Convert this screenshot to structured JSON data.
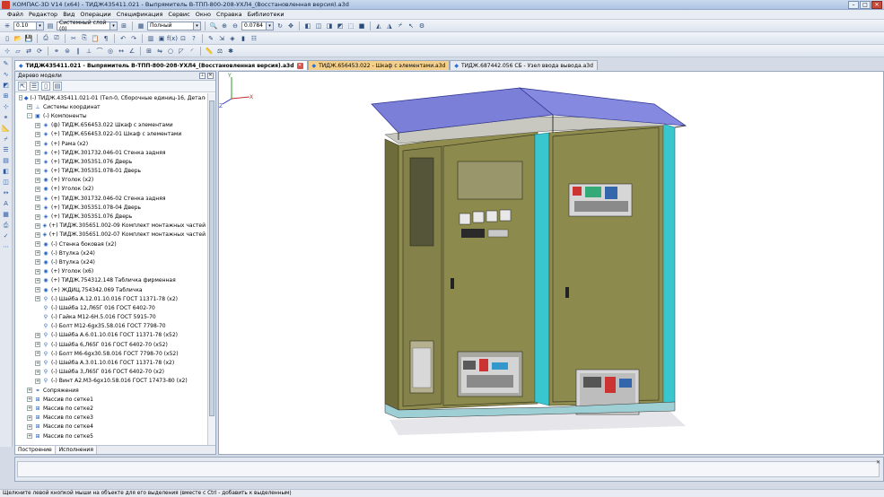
{
  "window": {
    "title": "КОМПАС-3D V14 (x64) - ТИДЖ435411.021 - Выпрямитель В-ТПП-800-208-УХЛ4_(Восстановленная версия).a3d"
  },
  "menu": [
    "Файл",
    "Редактор",
    "Вид",
    "Операции",
    "Спецификация",
    "Сервис",
    "Окно",
    "Справка",
    "Библиотеки"
  ],
  "toolbar": {
    "scale_value": "0.10",
    "layer_value": "Системный слой (0)",
    "view_mode_value": "Полный",
    "zoom_value": "0.0784"
  },
  "tabs": [
    {
      "label": "ТИДЖ435411.021 - Выпрямитель В-ТПП-800-208-УХЛ4_(Восстановленная версия).a3d",
      "active": true
    },
    {
      "label": "ТИДЖ.656453.022 - Шкаф с элементами.a3d",
      "active": false
    },
    {
      "label": "ТИДЖ.687442.056 СБ - Узел ввода вывода.a3d",
      "active": false
    }
  ],
  "tree": {
    "panel_title": "Дерево модели",
    "items": [
      {
        "level": 0,
        "exp": "-",
        "icon": "assembly-icon",
        "glyph": "◆",
        "label": "(-) ТИДЖ.435411.021-01 (Тел-0, Сборочные единиц-16, Деталей-225)"
      },
      {
        "level": 1,
        "exp": "+",
        "icon": "coord-icon",
        "glyph": "⊥",
        "label": "Системы координат"
      },
      {
        "level": 1,
        "exp": "-",
        "icon": "components-icon",
        "glyph": "▣",
        "label": "(-) Компоненты"
      },
      {
        "level": 2,
        "exp": "+",
        "icon": "subassembly-icon",
        "glyph": "◈",
        "label": "(ф) ТИДЖ.656453.022 Шкаф с элементами"
      },
      {
        "level": 2,
        "exp": "+",
        "icon": "subassembly-icon",
        "glyph": "◈",
        "label": "(+) ТИДЖ.656453.022-01 Шкаф с элементами"
      },
      {
        "level": 2,
        "exp": "+",
        "icon": "subassembly-icon",
        "glyph": "◈",
        "label": "(+) Рама (x2)"
      },
      {
        "level": 2,
        "exp": "+",
        "icon": "subassembly-icon",
        "glyph": "◈",
        "label": "(+) ТИДЖ.301732.046-01 Стенка задняя"
      },
      {
        "level": 2,
        "exp": "+",
        "icon": "subassembly-icon",
        "glyph": "◈",
        "label": "(+) ТИДЖ.305351.076 Дверь"
      },
      {
        "level": 2,
        "exp": "+",
        "icon": "subassembly-icon",
        "glyph": "◈",
        "label": "(+) ТИДЖ.305351.078-01 Дверь"
      },
      {
        "level": 2,
        "exp": "+",
        "icon": "part-icon",
        "glyph": "◉",
        "label": "(+) Уголок (x2)"
      },
      {
        "level": 2,
        "exp": "+",
        "icon": "part-icon",
        "glyph": "◉",
        "label": "(+) Уголок (x2)"
      },
      {
        "level": 2,
        "exp": "+",
        "icon": "subassembly-icon",
        "glyph": "◈",
        "label": "(+) ТИДЖ.301732.046-02 Стенка задняя"
      },
      {
        "level": 2,
        "exp": "+",
        "icon": "subassembly-icon",
        "glyph": "◈",
        "label": "(+) ТИДЖ.305351.078-04 Дверь"
      },
      {
        "level": 2,
        "exp": "+",
        "icon": "subassembly-icon",
        "glyph": "◈",
        "label": "(+) ТИДЖ.305351.076 Дверь"
      },
      {
        "level": 2,
        "exp": "+",
        "icon": "subassembly-icon",
        "glyph": "◈",
        "label": "(+) ТИДЖ.305651.002-09 Комплект монтажных частей"
      },
      {
        "level": 2,
        "exp": "+",
        "icon": "subassembly-icon",
        "glyph": "◈",
        "label": "(+) ТИДЖ.305651.002-07 Комплект монтажных частей"
      },
      {
        "level": 2,
        "exp": "+",
        "icon": "part-icon",
        "glyph": "◉",
        "label": "(-) Стенка боковая (x2)"
      },
      {
        "level": 2,
        "exp": "+",
        "icon": "part-icon",
        "glyph": "◉",
        "label": "(-) Втулка (x24)"
      },
      {
        "level": 2,
        "exp": "+",
        "icon": "part-icon",
        "glyph": "◉",
        "label": "(-) Втулка (x24)"
      },
      {
        "level": 2,
        "exp": "+",
        "icon": "part-icon",
        "glyph": "◉",
        "label": "(+) Уголок (x6)"
      },
      {
        "level": 2,
        "exp": "+",
        "icon": "part-icon",
        "glyph": "◉",
        "label": "(+) ТИДЖ.754312.148 Табличка фирменная"
      },
      {
        "level": 2,
        "exp": "+",
        "icon": "part-icon",
        "glyph": "◉",
        "label": "(+) ЖДИЦ.754342.069 Табличка"
      },
      {
        "level": 2,
        "exp": "+",
        "icon": "standard-icon",
        "glyph": "⚲",
        "label": "(-) Шайба А.12.01.10.016 ГОСТ 11371-78 (x2)"
      },
      {
        "level": 2,
        "exp": "",
        "icon": "standard-icon",
        "glyph": "⚲",
        "label": "(-) Шайба 12,Л65Г 016 ГОСТ 6402-70"
      },
      {
        "level": 2,
        "exp": "",
        "icon": "standard-icon",
        "glyph": "⚲",
        "label": "(-) Гайка М12-6Н.5.016 ГОСТ 5915-70"
      },
      {
        "level": 2,
        "exp": "",
        "icon": "standard-icon",
        "glyph": "⚲",
        "label": "(-) Болт М12-6gх35.58.016 ГОСТ 7798-70"
      },
      {
        "level": 2,
        "exp": "+",
        "icon": "standard-icon",
        "glyph": "⚲",
        "label": "(-) Шайба А.6.01.10.016 ГОСТ 11371-78 (x52)"
      },
      {
        "level": 2,
        "exp": "+",
        "icon": "standard-icon",
        "glyph": "⚲",
        "label": "(-) Шайба 6,Л65Г 016 ГОСТ 6402-70 (x52)"
      },
      {
        "level": 2,
        "exp": "+",
        "icon": "standard-icon",
        "glyph": "⚲",
        "label": "(-) Болт М6-6gх30.58.016 ГОСТ 7798-70 (x52)"
      },
      {
        "level": 2,
        "exp": "+",
        "icon": "standard-icon",
        "glyph": "⚲",
        "label": "(-) Шайба А.3.01.10.016 ГОСТ 11371-78 (x2)"
      },
      {
        "level": 2,
        "exp": "+",
        "icon": "standard-icon",
        "glyph": "⚲",
        "label": "(-) Шайба 3,Л65Г 016 ГОСТ 6402-70 (x2)"
      },
      {
        "level": 2,
        "exp": "+",
        "icon": "standard-icon",
        "glyph": "⚲",
        "label": "(-) Винт А2.М3-6gх10.58.016 ГОСТ 17473-80 (x2)"
      },
      {
        "level": 1,
        "exp": "+",
        "icon": "mates-icon",
        "glyph": "⚭",
        "label": "Сопряжения"
      },
      {
        "level": 1,
        "exp": "+",
        "icon": "array-icon",
        "glyph": "⊞",
        "label": "Массив по сетке1"
      },
      {
        "level": 1,
        "exp": "+",
        "icon": "array-icon",
        "glyph": "⊞",
        "label": "Массив по сетке2"
      },
      {
        "level": 1,
        "exp": "+",
        "icon": "array-icon",
        "glyph": "⊞",
        "label": "Массив по сетке3"
      },
      {
        "level": 1,
        "exp": "+",
        "icon": "array-icon",
        "glyph": "⊞",
        "label": "Массив по сетке4"
      },
      {
        "level": 1,
        "exp": "+",
        "icon": "array-icon",
        "glyph": "⊞",
        "label": "Массив по сетке5"
      }
    ],
    "bottom_tabs": [
      "Построение",
      "Исполнения"
    ]
  },
  "viewport": {
    "axis_x_label": "X",
    "axis_y_label": "Y",
    "axis_z_label": "Z"
  },
  "status": {
    "text": "Щелкните левой кнопкой мыши на объекте для его выделения (вместе с Ctrl - добавить к выделенным)"
  },
  "colors": {
    "cabinet_body": "#8f8c4e",
    "cabinet_dark": "#5f5e34",
    "roof": "#7b7fd8",
    "frame_cyan": "#39c6cf"
  }
}
